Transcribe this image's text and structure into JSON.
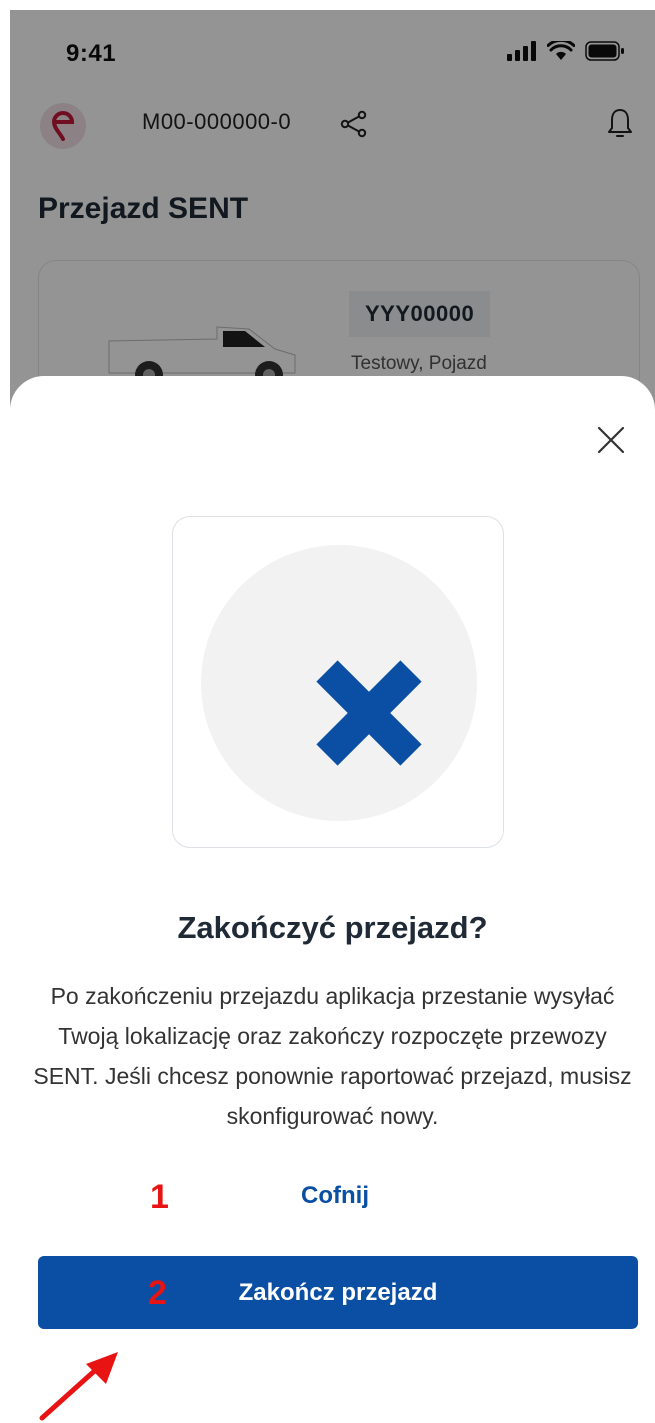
{
  "status_bar": {
    "time": "9:41"
  },
  "header": {
    "vehicle_id": "M00-000000-0"
  },
  "page": {
    "title": "Przejazd SENT"
  },
  "vehicle": {
    "plate": "YYY00000",
    "name": "Testowy, Pojazd"
  },
  "dialog": {
    "title": "Zakończyć przejazd?",
    "description": "Po zakończeniu przejazdu aplikacja przestanie wysyłać Twoją lokalizację oraz zakończy rozpoczęte przewozy SENT. Jeśli chcesz ponownie raportować przejazd, musisz skonfigurować nowy.",
    "back_label": "Cofnij",
    "confirm_label": "Zakończ przejazd"
  },
  "annotations": {
    "step1": "1",
    "step2": "2"
  },
  "colors": {
    "primary": "#0a4fa3",
    "annotation_red": "#e81313",
    "logo_red": "#c2183a",
    "icon_blue": "#0a4fa3"
  },
  "icons": {
    "logo": "e-pin-logo",
    "share": "share-icon",
    "bell": "bell-icon",
    "close": "close-icon",
    "illustration": "x-mark-icon"
  }
}
